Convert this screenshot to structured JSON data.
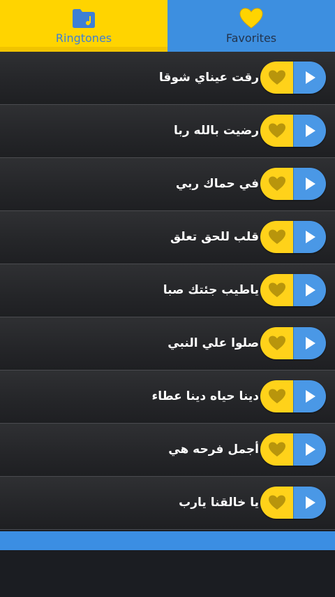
{
  "tabs": {
    "ringtones_label": "Ringtones",
    "favorites_label": "Favorites",
    "ringtones_icon": "folder-music-icon",
    "favorites_icon": "heart-icon",
    "active": "ringtones"
  },
  "rows": [
    {
      "title": "رقت عيناي شوقا"
    },
    {
      "title": "رضيت بالله ربا"
    },
    {
      "title": "في حماك ربي"
    },
    {
      "title": "قلب للحق تعلق"
    },
    {
      "title": "ياطيب جئتك صبا"
    },
    {
      "title": "صلوا علي النبي"
    },
    {
      "title": "دينا حياه دينا عطاء"
    },
    {
      "title": "أجمل فرحه هي"
    },
    {
      "title": "يا خالقنا يارب"
    }
  ],
  "row_icons": {
    "favorite": "heart-icon",
    "play": "play-icon"
  },
  "colors": {
    "yellow": "#ffd400",
    "blue": "#3d8fe0",
    "background": "#1b1d22"
  }
}
